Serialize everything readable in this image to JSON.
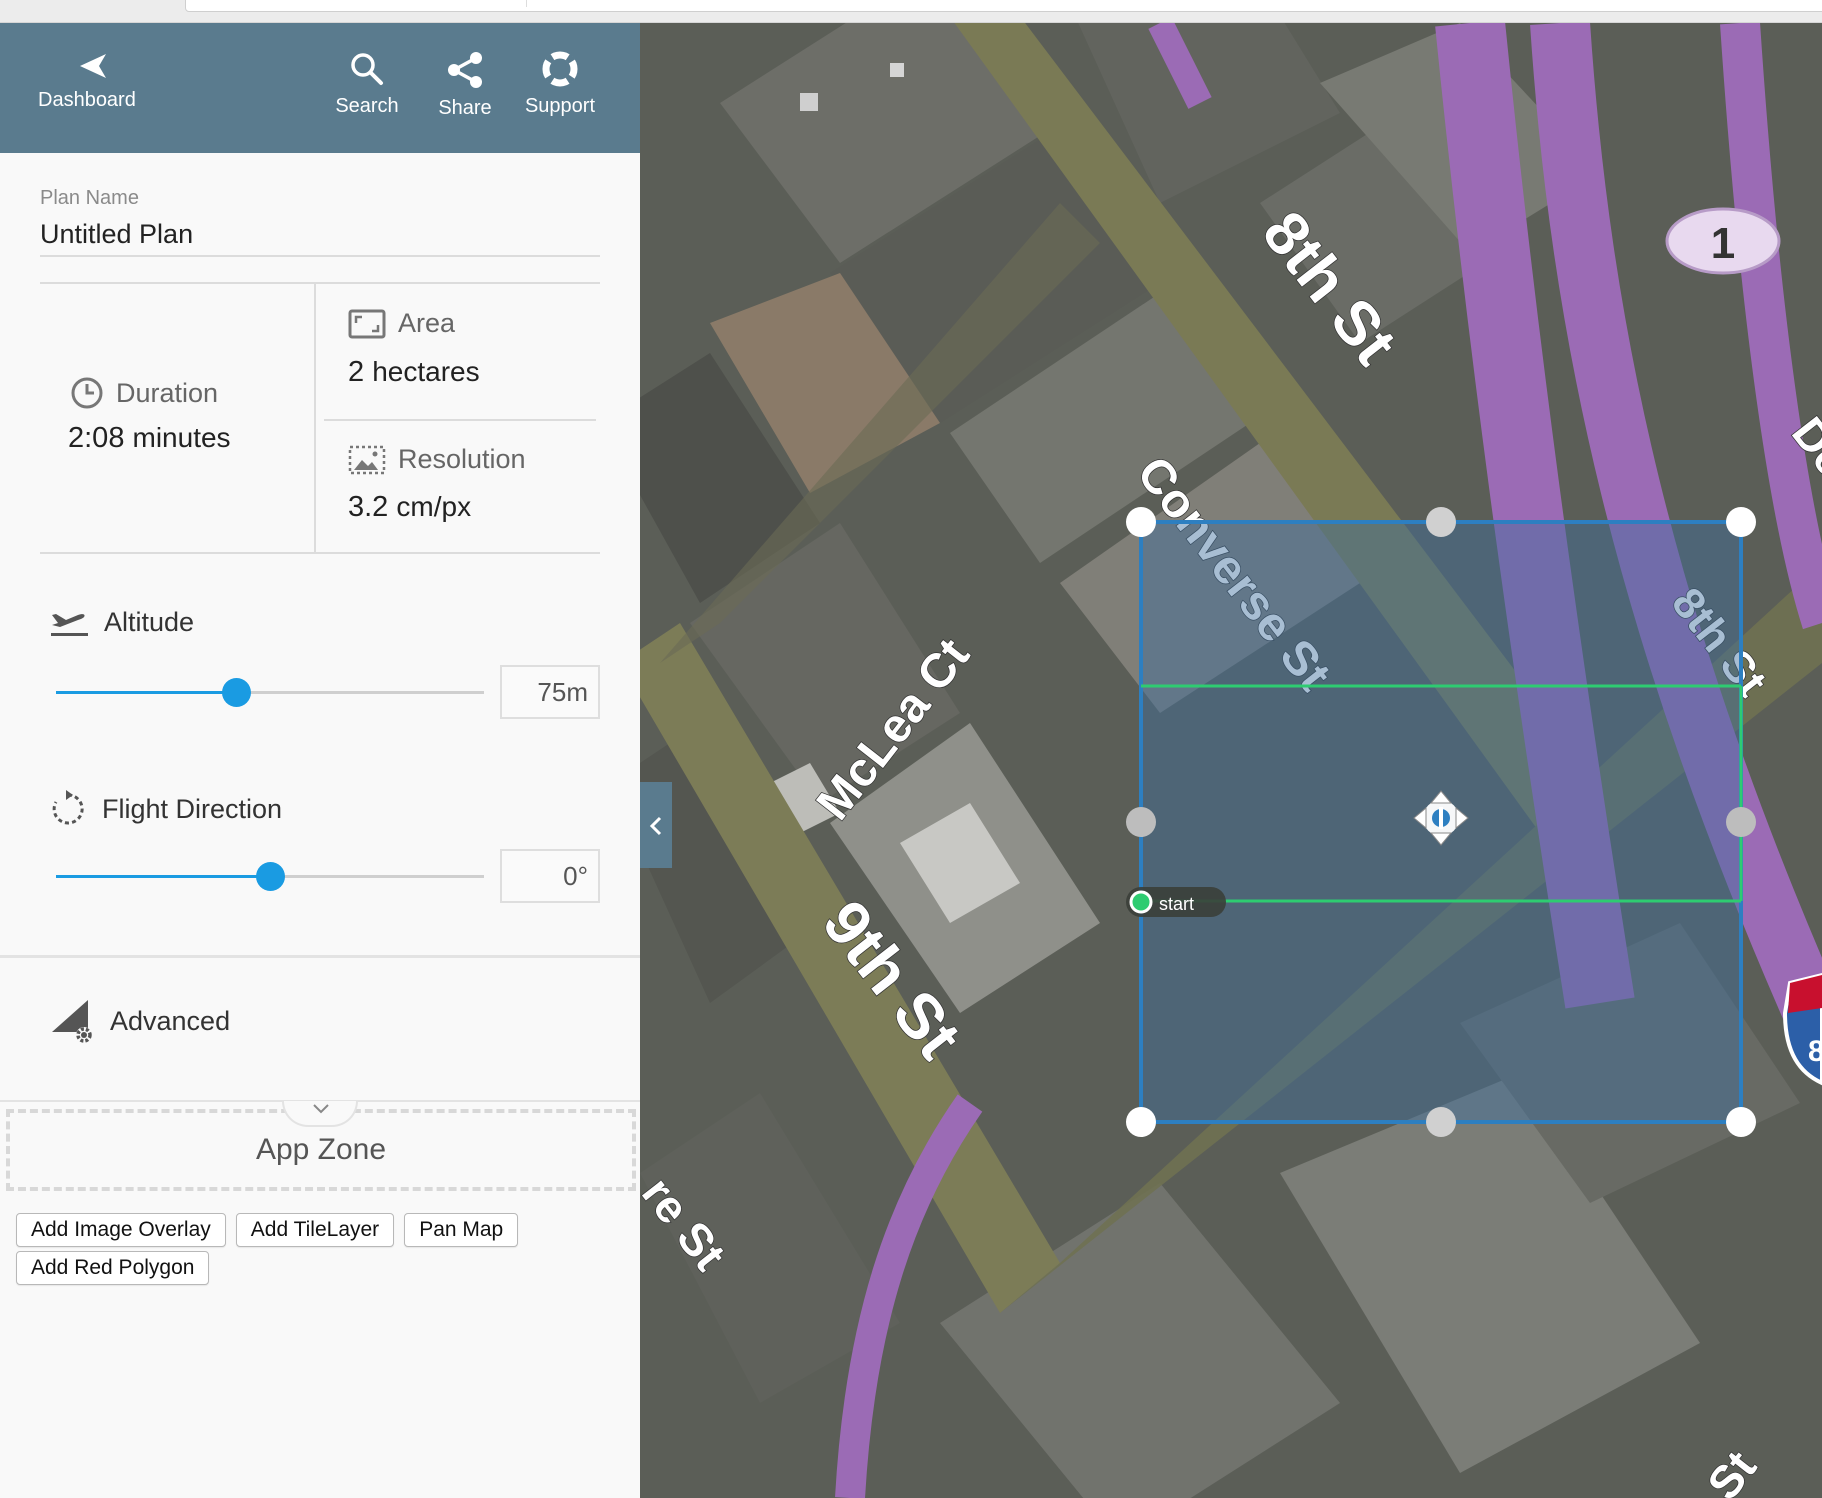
{
  "nav": {
    "dashboard_label": "Dashboard",
    "search_label": "Search",
    "share_label": "Share",
    "support_label": "Support"
  },
  "plan": {
    "name_label": "Plan Name",
    "name_value": "Untitled Plan"
  },
  "stats": {
    "duration_label": "Duration",
    "duration_value": "2:08",
    "duration_unit": "minutes",
    "area_label": "Area",
    "area_value": "2",
    "area_unit": "hectares",
    "resolution_label": "Resolution",
    "resolution_value": "3.2",
    "resolution_unit": "cm/px"
  },
  "altitude": {
    "label": "Altitude",
    "value": "75m",
    "slider_fraction": 0.42
  },
  "flight_direction": {
    "label": "Flight Direction",
    "value": "0°",
    "slider_fraction": 0.5
  },
  "advanced": {
    "label": "Advanced"
  },
  "app_zone": {
    "label": "App Zone"
  },
  "buttons": {
    "add_image_overlay": "Add Image Overlay",
    "add_tile_layer": "Add TileLayer",
    "pan_map": "Pan Map",
    "add_red_polygon": "Add Red Polygon"
  },
  "map": {
    "streets": {
      "eighth_st_upper": "8th St",
      "converse_st": "Converse St",
      "eighth_st_right": "8th St",
      "mclea_ct": "McLea Ct",
      "ninth_st": "9th St",
      "re_st": "re St",
      "de_partial": "De",
      "st_bottom_right": "St"
    },
    "highway_shield": "1",
    "interstate_partial": "8",
    "start_marker_label": "start"
  },
  "colors": {
    "header_bg": "#5a7b8e",
    "accent_blue": "#1a9be2",
    "polygon_stroke": "#2d7fc1",
    "flight_line": "#2ecc71",
    "highway_purple": "#9b6bb5"
  }
}
